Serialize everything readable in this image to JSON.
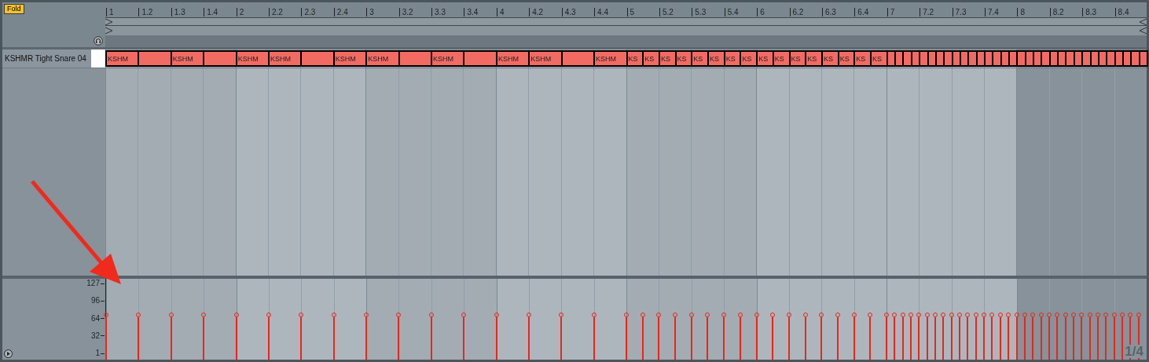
{
  "fold_button": {
    "label": "Fold"
  },
  "ruler": [
    "1",
    "1.2",
    "1.3",
    "1.4",
    "2",
    "2.2",
    "2.3",
    "2.4",
    "3",
    "3.2",
    "3.3",
    "3.4",
    "4",
    "4.2",
    "4.3",
    "4.4",
    "5",
    "5.2",
    "5.3",
    "5.4",
    "6",
    "6.2",
    "6.3",
    "6.4",
    "7",
    "7.2",
    "7.3",
    "7.4",
    "8",
    "8.2",
    "8.3",
    "8.4"
  ],
  "track": {
    "name": "KSHMR Tight Snare 04"
  },
  "notes": [
    {
      "kind": "quarter",
      "label": "KSHM"
    },
    {
      "kind": "quarter"
    },
    {
      "kind": "quarter",
      "label": "KSHM"
    },
    {
      "kind": "quarter"
    },
    {
      "kind": "quarter",
      "label": "KSHM"
    },
    {
      "kind": "quarter",
      "label": "KSHM"
    },
    {
      "kind": "quarter"
    },
    {
      "kind": "quarter",
      "label": "KSHM"
    },
    {
      "kind": "quarter",
      "label": "KSHM"
    },
    {
      "kind": "quarter"
    },
    {
      "kind": "quarter",
      "label": "KSHM"
    },
    {
      "kind": "quarter"
    },
    {
      "kind": "quarter",
      "label": "KSHM"
    },
    {
      "kind": "quarter",
      "label": "KSHM"
    },
    {
      "kind": "quarter"
    },
    {
      "kind": "quarter",
      "label": "KSHM"
    },
    {
      "kind": "eighth",
      "label": "KS"
    },
    {
      "kind": "eighth",
      "label": "KS"
    },
    {
      "kind": "eighth",
      "label": "KS"
    },
    {
      "kind": "eighth",
      "label": "KS"
    },
    {
      "kind": "eighth",
      "label": "KS"
    },
    {
      "kind": "eighth",
      "label": "KS"
    },
    {
      "kind": "eighth",
      "label": "KS"
    },
    {
      "kind": "eighth",
      "label": "KS"
    },
    {
      "kind": "eighth",
      "label": "KS"
    },
    {
      "kind": "eighth",
      "label": "KS"
    },
    {
      "kind": "eighth",
      "label": "KS"
    },
    {
      "kind": "eighth",
      "label": "KS"
    },
    {
      "kind": "eighth",
      "label": "KS"
    },
    {
      "kind": "eighth",
      "label": "KS"
    },
    {
      "kind": "eighth",
      "label": "KS"
    },
    {
      "kind": "eighth",
      "label": "KS"
    },
    {
      "kind": "sixteenth"
    },
    {
      "kind": "sixteenth"
    },
    {
      "kind": "sixteenth"
    },
    {
      "kind": "sixteenth"
    },
    {
      "kind": "sixteenth"
    },
    {
      "kind": "sixteenth"
    },
    {
      "kind": "sixteenth"
    },
    {
      "kind": "sixteenth"
    },
    {
      "kind": "sixteenth"
    },
    {
      "kind": "sixteenth"
    },
    {
      "kind": "sixteenth"
    },
    {
      "kind": "sixteenth"
    },
    {
      "kind": "sixteenth"
    },
    {
      "kind": "sixteenth"
    },
    {
      "kind": "sixteenth"
    },
    {
      "kind": "sixteenth"
    },
    {
      "kind": "sixteenth"
    },
    {
      "kind": "sixteenth"
    },
    {
      "kind": "sixteenth"
    },
    {
      "kind": "sixteenth"
    },
    {
      "kind": "sixteenth"
    },
    {
      "kind": "sixteenth"
    },
    {
      "kind": "sixteenth"
    },
    {
      "kind": "sixteenth"
    },
    {
      "kind": "sixteenth"
    },
    {
      "kind": "sixteenth"
    },
    {
      "kind": "sixteenth"
    },
    {
      "kind": "sixteenth"
    },
    {
      "kind": "sixteenth"
    },
    {
      "kind": "sixteenth"
    },
    {
      "kind": "sixteenth"
    },
    {
      "kind": "sixteenth"
    }
  ],
  "velocity_axis": [
    "127",
    "96",
    "64",
    "32",
    "1"
  ],
  "grid": {
    "label": "1/4"
  }
}
